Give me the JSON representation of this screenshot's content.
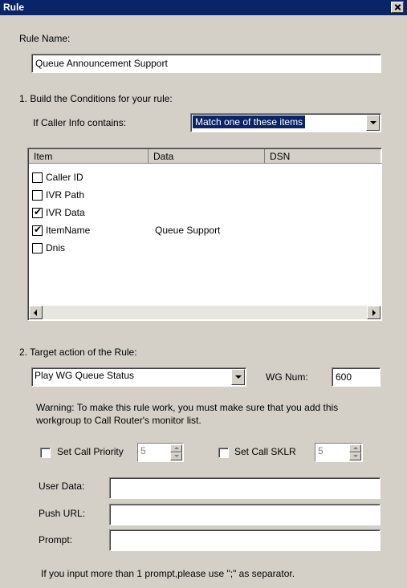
{
  "window": {
    "title": "Rule"
  },
  "rule_name": {
    "label": "Rule Name:",
    "value": "Queue Announcement Support"
  },
  "conditions": {
    "heading": "1. Build the Conditions for your rule:",
    "caller_info_label": "If Caller Info contains:",
    "match_select": "Match one of these items",
    "columns": [
      "Item",
      "Data",
      "DSN"
    ],
    "rows": [
      {
        "item": "Caller ID",
        "data": "",
        "checked": false
      },
      {
        "item": "IVR Path",
        "data": "",
        "checked": false
      },
      {
        "item": "IVR Data",
        "data": "",
        "checked": true
      },
      {
        "item": "ItemName",
        "data": "Queue Support",
        "checked": true
      },
      {
        "item": "Dnis",
        "data": "",
        "checked": false
      }
    ]
  },
  "target": {
    "heading": "2. Target action of the Rule:",
    "action_select": "Play WG Queue Status",
    "wg_num_label": "WG Num:",
    "wg_num_value": "600",
    "warning_line1": "Warning: To make this rule work, you must make sure that you add this",
    "warning_line2": "workgroup to Call Router's monitor list.",
    "set_call_priority_label": "Set Call Priority",
    "set_call_priority_value": "5",
    "set_call_sklr_label": "Set Call SKLR",
    "set_call_sklr_value": "5",
    "user_data_label": "User Data:",
    "user_data_value": "",
    "push_url_label": "Push URL:",
    "push_url_value": "",
    "prompt_label": "Prompt:",
    "prompt_value": "",
    "footer_note": "If you input more than 1 prompt,please use \";\" as separator."
  }
}
